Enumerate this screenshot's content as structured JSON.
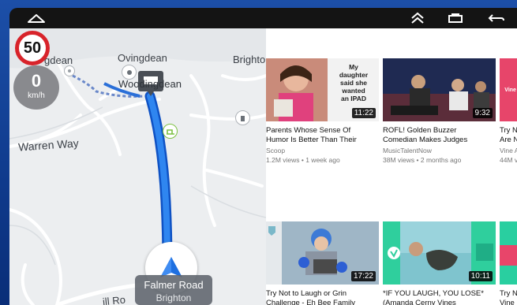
{
  "statusbar": {
    "home_icon": "home-outline-icon",
    "collapse_icon": "double-chevron-up-icon",
    "recents_icon": "recent-apps-icon",
    "back_icon": "back-arrow-icon"
  },
  "map": {
    "speed_limit": "50",
    "current_speed": "0",
    "speed_unit": "km/h",
    "labels": {
      "top_left": "gdean",
      "ovingdean": "Ovingdean",
      "brighton_top": "Brighto",
      "woodingdean": "Woodingdean",
      "warren_way": "Warren Way",
      "bottom_road": "ill Ro"
    },
    "current_road": "Falmer Road",
    "current_town": "Brighton",
    "route_color": "#1e6fe0"
  },
  "videos": [
    {
      "title": "Parents Whose Sense Of\nHumor Is Better Than Their",
      "channel": "Scoop",
      "meta": "1.2M views • 1 week ago",
      "duration": "11:22",
      "thumb_text": "My\ndaughter\nsaid she\nwanted\nan IPAD"
    },
    {
      "title": "ROFL! Golden Buzzer\nComedian Makes Judges",
      "channel": "MusicTalentNow",
      "meta": "38M views • 2 months ago",
      "duration": "9:32",
      "thumb_text": ""
    },
    {
      "title": "Try N\nAre N",
      "channel": "Vine A",
      "meta": "44M v",
      "duration": "",
      "thumb_text": "Vine A"
    },
    {
      "title": "Try Not to Laugh or Grin\nChallenge - Eh Bee Family",
      "channel": "",
      "meta": "",
      "duration": "17:22",
      "thumb_text": ""
    },
    {
      "title": "*IF YOU LAUGH, YOU LOSE*\n(Amanda Cerny Vines",
      "channel": "",
      "meta": "",
      "duration": "10:11",
      "thumb_text": ""
    },
    {
      "title": "Try N\nVine",
      "channel": "",
      "meta": "",
      "duration": "",
      "thumb_text": ""
    }
  ]
}
